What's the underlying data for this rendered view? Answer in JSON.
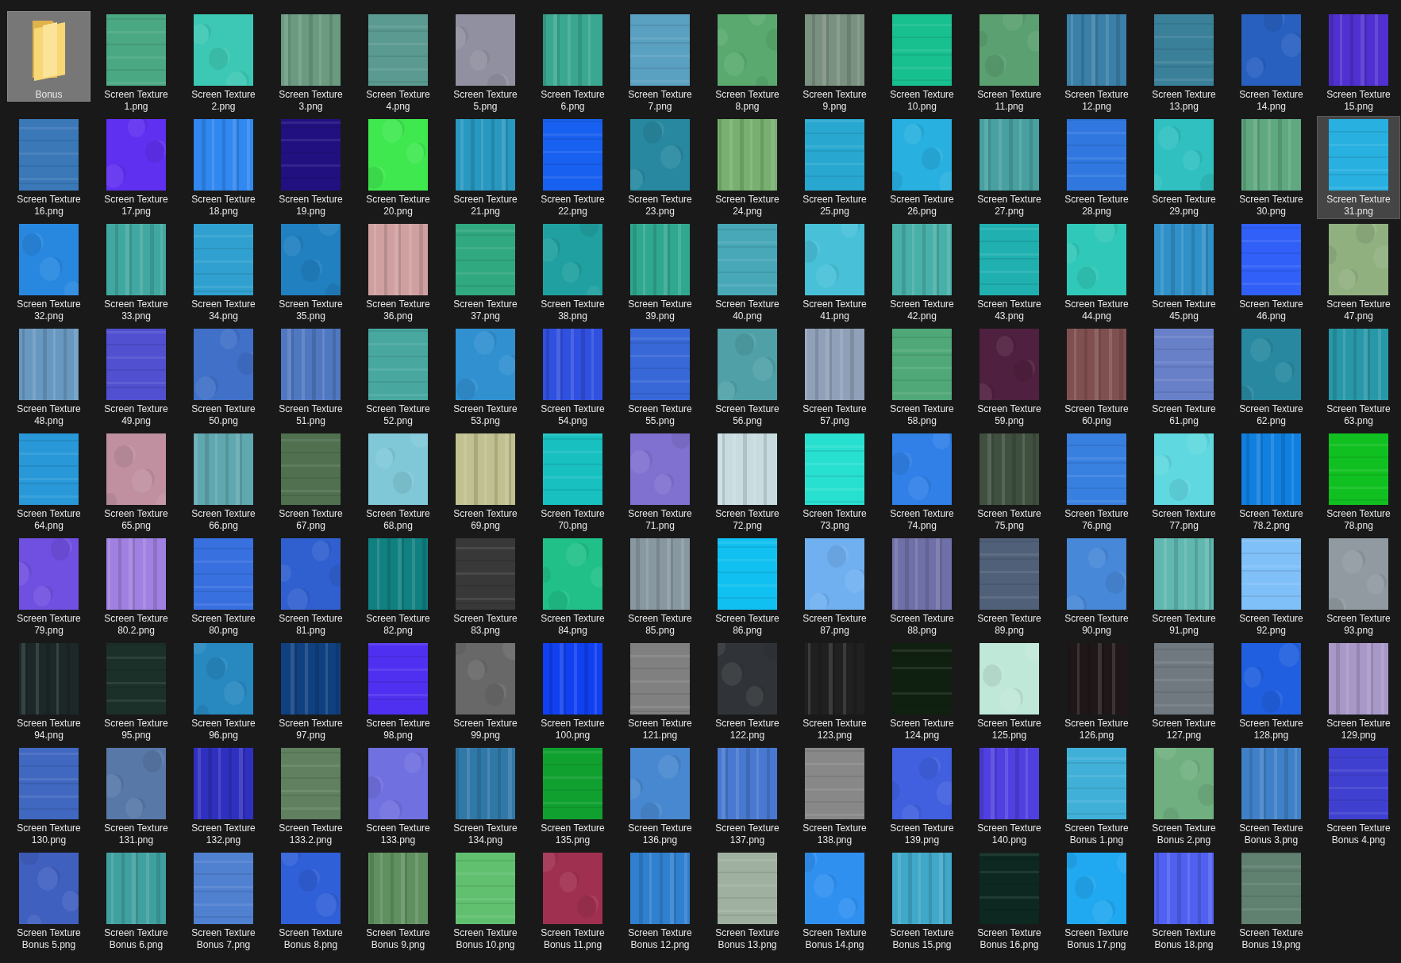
{
  "items": [
    {
      "kind": "folder",
      "label": "Bonus",
      "selected": true,
      "hovered": false
    },
    {
      "kind": "picture",
      "label": "Screen Texture 1.png",
      "selected": false,
      "hovered": false
    },
    {
      "kind": "picture",
      "label": "Screen Texture 2.png",
      "selected": false,
      "hovered": false
    },
    {
      "kind": "picture",
      "label": "Screen Texture 3.png",
      "selected": false,
      "hovered": false
    },
    {
      "kind": "picture",
      "label": "Screen Texture 4.png",
      "selected": false,
      "hovered": false
    },
    {
      "kind": "picture",
      "label": "Screen Texture 5.png",
      "selected": false,
      "hovered": false
    },
    {
      "kind": "picture",
      "label": "Screen Texture 6.png",
      "selected": false,
      "hovered": false
    },
    {
      "kind": "picture",
      "label": "Screen Texture 7.png",
      "selected": false,
      "hovered": false
    },
    {
      "kind": "picture",
      "label": "Screen Texture 8.png",
      "selected": false,
      "hovered": false
    },
    {
      "kind": "picture",
      "label": "Screen Texture 9.png",
      "selected": false,
      "hovered": false
    },
    {
      "kind": "picture",
      "label": "Screen Texture 10.png",
      "selected": false,
      "hovered": false
    },
    {
      "kind": "picture",
      "label": "Screen Texture 11.png",
      "selected": false,
      "hovered": false
    },
    {
      "kind": "picture",
      "label": "Screen Texture 12.png",
      "selected": false,
      "hovered": false
    },
    {
      "kind": "picture",
      "label": "Screen Texture 13.png",
      "selected": false,
      "hovered": false
    },
    {
      "kind": "picture",
      "label": "Screen Texture 14.png",
      "selected": false,
      "hovered": false
    },
    {
      "kind": "picture",
      "label": "Screen Texture 15.png",
      "selected": false,
      "hovered": false
    },
    {
      "kind": "picture",
      "label": "Screen Texture 16.png",
      "selected": false,
      "hovered": false
    },
    {
      "kind": "picture",
      "label": "Screen Texture 17.png",
      "selected": false,
      "hovered": false
    },
    {
      "kind": "picture",
      "label": "Screen Texture 18.png",
      "selected": false,
      "hovered": false
    },
    {
      "kind": "picture",
      "label": "Screen Texture 19.png",
      "selected": false,
      "hovered": false
    },
    {
      "kind": "picture",
      "label": "Screen Texture 20.png",
      "selected": false,
      "hovered": false
    },
    {
      "kind": "picture",
      "label": "Screen Texture 21.png",
      "selected": false,
      "hovered": false
    },
    {
      "kind": "picture",
      "label": "Screen Texture 22.png",
      "selected": false,
      "hovered": false
    },
    {
      "kind": "picture",
      "label": "Screen Texture 23.png",
      "selected": false,
      "hovered": false
    },
    {
      "kind": "picture",
      "label": "Screen Texture 24.png",
      "selected": false,
      "hovered": false
    },
    {
      "kind": "picture",
      "label": "Screen Texture 25.png",
      "selected": false,
      "hovered": false
    },
    {
      "kind": "picture",
      "label": "Screen Texture 26.png",
      "selected": false,
      "hovered": false
    },
    {
      "kind": "picture",
      "label": "Screen Texture 27.png",
      "selected": false,
      "hovered": false
    },
    {
      "kind": "picture",
      "label": "Screen Texture 28.png",
      "selected": false,
      "hovered": false
    },
    {
      "kind": "picture",
      "label": "Screen Texture 29.png",
      "selected": false,
      "hovered": false
    },
    {
      "kind": "picture",
      "label": "Screen Texture 30.png",
      "selected": false,
      "hovered": false
    },
    {
      "kind": "picture",
      "label": "Screen Texture 31.png",
      "selected": false,
      "hovered": true
    },
    {
      "kind": "picture",
      "label": "Screen Texture 32.png",
      "selected": false,
      "hovered": false
    },
    {
      "kind": "picture",
      "label": "Screen Texture 33.png",
      "selected": false,
      "hovered": false
    },
    {
      "kind": "picture",
      "label": "Screen Texture 34.png",
      "selected": false,
      "hovered": false
    },
    {
      "kind": "picture",
      "label": "Screen Texture 35.png",
      "selected": false,
      "hovered": false
    },
    {
      "kind": "picture",
      "label": "Screen Texture 36.png",
      "selected": false,
      "hovered": false
    },
    {
      "kind": "picture",
      "label": "Screen Texture 37.png",
      "selected": false,
      "hovered": false
    },
    {
      "kind": "picture",
      "label": "Screen Texture 38.png",
      "selected": false,
      "hovered": false
    },
    {
      "kind": "picture",
      "label": "Screen Texture 39.png",
      "selected": false,
      "hovered": false
    },
    {
      "kind": "picture",
      "label": "Screen Texture 40.png",
      "selected": false,
      "hovered": false
    },
    {
      "kind": "picture",
      "label": "Screen Texture 41.png",
      "selected": false,
      "hovered": false
    },
    {
      "kind": "picture",
      "label": "Screen Texture 42.png",
      "selected": false,
      "hovered": false
    },
    {
      "kind": "picture",
      "label": "Screen Texture 43.png",
      "selected": false,
      "hovered": false
    },
    {
      "kind": "picture",
      "label": "Screen Texture 44.png",
      "selected": false,
      "hovered": false
    },
    {
      "kind": "picture",
      "label": "Screen Texture 45.png",
      "selected": false,
      "hovered": false
    },
    {
      "kind": "picture",
      "label": "Screen Texture 46.png",
      "selected": false,
      "hovered": false
    },
    {
      "kind": "picture",
      "label": "Screen Texture 47.png",
      "selected": false,
      "hovered": false
    },
    {
      "kind": "picture",
      "label": "Screen Texture 48.png",
      "selected": false,
      "hovered": false
    },
    {
      "kind": "picture",
      "label": "Screen Texture 49.png",
      "selected": false,
      "hovered": false
    },
    {
      "kind": "picture",
      "label": "Screen Texture 50.png",
      "selected": false,
      "hovered": false
    },
    {
      "kind": "picture",
      "label": "Screen Texture 51.png",
      "selected": false,
      "hovered": false
    },
    {
      "kind": "picture",
      "label": "Screen Texture 52.png",
      "selected": false,
      "hovered": false
    },
    {
      "kind": "picture",
      "label": "Screen Texture 53.png",
      "selected": false,
      "hovered": false
    },
    {
      "kind": "picture",
      "label": "Screen Texture 54.png",
      "selected": false,
      "hovered": false
    },
    {
      "kind": "picture",
      "label": "Screen Texture 55.png",
      "selected": false,
      "hovered": false
    },
    {
      "kind": "picture",
      "label": "Screen Texture 56.png",
      "selected": false,
      "hovered": false
    },
    {
      "kind": "picture",
      "label": "Screen Texture 57.png",
      "selected": false,
      "hovered": false
    },
    {
      "kind": "picture",
      "label": "Screen Texture 58.png",
      "selected": false,
      "hovered": false
    },
    {
      "kind": "picture",
      "label": "Screen Texture 59.png",
      "selected": false,
      "hovered": false
    },
    {
      "kind": "picture",
      "label": "Screen Texture 60.png",
      "selected": false,
      "hovered": false
    },
    {
      "kind": "picture",
      "label": "Screen Texture 61.png",
      "selected": false,
      "hovered": false
    },
    {
      "kind": "picture",
      "label": "Screen Texture 62.png",
      "selected": false,
      "hovered": false
    },
    {
      "kind": "picture",
      "label": "Screen Texture 63.png",
      "selected": false,
      "hovered": false
    },
    {
      "kind": "picture",
      "label": "Screen Texture 64.png",
      "selected": false,
      "hovered": false
    },
    {
      "kind": "picture",
      "label": "Screen Texture 65.png",
      "selected": false,
      "hovered": false
    },
    {
      "kind": "picture",
      "label": "Screen Texture 66.png",
      "selected": false,
      "hovered": false
    },
    {
      "kind": "picture",
      "label": "Screen Texture 67.png",
      "selected": false,
      "hovered": false
    },
    {
      "kind": "picture",
      "label": "Screen Texture 68.png",
      "selected": false,
      "hovered": false
    },
    {
      "kind": "picture",
      "label": "Screen Texture 69.png",
      "selected": false,
      "hovered": false
    },
    {
      "kind": "picture",
      "label": "Screen Texture 70.png",
      "selected": false,
      "hovered": false
    },
    {
      "kind": "picture",
      "label": "Screen Texture 71.png",
      "selected": false,
      "hovered": false
    },
    {
      "kind": "picture",
      "label": "Screen Texture 72.png",
      "selected": false,
      "hovered": false
    },
    {
      "kind": "picture",
      "label": "Screen Texture 73.png",
      "selected": false,
      "hovered": false
    },
    {
      "kind": "picture",
      "label": "Screen Texture 74.png",
      "selected": false,
      "hovered": false
    },
    {
      "kind": "picture",
      "label": "Screen Texture 75.png",
      "selected": false,
      "hovered": false
    },
    {
      "kind": "picture",
      "label": "Screen Texture 76.png",
      "selected": false,
      "hovered": false
    },
    {
      "kind": "picture",
      "label": "Screen Texture 77.png",
      "selected": false,
      "hovered": false
    },
    {
      "kind": "picture",
      "label": "Screen Texture 78.2.png",
      "selected": false,
      "hovered": false
    },
    {
      "kind": "picture",
      "label": "Screen Texture 78.png",
      "selected": false,
      "hovered": false
    },
    {
      "kind": "picture",
      "label": "Screen Texture 79.png",
      "selected": false,
      "hovered": false
    },
    {
      "kind": "picture",
      "label": "Screen Texture 80.2.png",
      "selected": false,
      "hovered": false
    },
    {
      "kind": "picture",
      "label": "Screen Texture 80.png",
      "selected": false,
      "hovered": false
    },
    {
      "kind": "picture",
      "label": "Screen Texture 81.png",
      "selected": false,
      "hovered": false
    },
    {
      "kind": "picture",
      "label": "Screen Texture 82.png",
      "selected": false,
      "hovered": false
    },
    {
      "kind": "picture",
      "label": "Screen Texture 83.png",
      "selected": false,
      "hovered": false
    },
    {
      "kind": "picture",
      "label": "Screen Texture 84.png",
      "selected": false,
      "hovered": false
    },
    {
      "kind": "picture",
      "label": "Screen Texture 85.png",
      "selected": false,
      "hovered": false
    },
    {
      "kind": "picture",
      "label": "Screen Texture 86.png",
      "selected": false,
      "hovered": false
    },
    {
      "kind": "picture",
      "label": "Screen Texture 87.png",
      "selected": false,
      "hovered": false
    },
    {
      "kind": "picture",
      "label": "Screen Texture 88.png",
      "selected": false,
      "hovered": false
    },
    {
      "kind": "picture",
      "label": "Screen Texture 89.png",
      "selected": false,
      "hovered": false
    },
    {
      "kind": "picture",
      "label": "Screen Texture 90.png",
      "selected": false,
      "hovered": false
    },
    {
      "kind": "picture",
      "label": "Screen Texture 91.png",
      "selected": false,
      "hovered": false
    },
    {
      "kind": "picture",
      "label": "Screen Texture 92.png",
      "selected": false,
      "hovered": false
    },
    {
      "kind": "picture",
      "label": "Screen Texture 93.png",
      "selected": false,
      "hovered": false
    },
    {
      "kind": "picture",
      "label": "Screen Texture 94.png",
      "selected": false,
      "hovered": false
    },
    {
      "kind": "picture",
      "label": "Screen Texture 95.png",
      "selected": false,
      "hovered": false
    },
    {
      "kind": "picture",
      "label": "Screen Texture 96.png",
      "selected": false,
      "hovered": false
    },
    {
      "kind": "picture",
      "label": "Screen Texture 97.png",
      "selected": false,
      "hovered": false
    },
    {
      "kind": "picture",
      "label": "Screen Texture 98.png",
      "selected": false,
      "hovered": false
    },
    {
      "kind": "picture",
      "label": "Screen Texture 99.png",
      "selected": false,
      "hovered": false
    },
    {
      "kind": "picture",
      "label": "Screen Texture 100.png",
      "selected": false,
      "hovered": false
    },
    {
      "kind": "picture",
      "label": "Screen Texture 121.png",
      "selected": false,
      "hovered": false
    },
    {
      "kind": "picture",
      "label": "Screen Texture 122.png",
      "selected": false,
      "hovered": false
    },
    {
      "kind": "picture",
      "label": "Screen Texture 123.png",
      "selected": false,
      "hovered": false
    },
    {
      "kind": "picture",
      "label": "Screen Texture 124.png",
      "selected": false,
      "hovered": false
    },
    {
      "kind": "picture",
      "label": "Screen Texture 125.png",
      "selected": false,
      "hovered": false
    },
    {
      "kind": "picture",
      "label": "Screen Texture 126.png",
      "selected": false,
      "hovered": false
    },
    {
      "kind": "picture",
      "label": "Screen Texture 127.png",
      "selected": false,
      "hovered": false
    },
    {
      "kind": "picture",
      "label": "Screen Texture 128.png",
      "selected": false,
      "hovered": false
    },
    {
      "kind": "picture",
      "label": "Screen Texture 129.png",
      "selected": false,
      "hovered": false
    },
    {
      "kind": "picture",
      "label": "Screen Texture 130.png",
      "selected": false,
      "hovered": false
    },
    {
      "kind": "picture",
      "label": "Screen Texture 131.png",
      "selected": false,
      "hovered": false
    },
    {
      "kind": "picture",
      "label": "Screen Texture 132.png",
      "selected": false,
      "hovered": false
    },
    {
      "kind": "picture",
      "label": "Screen Texture 133.2.png",
      "selected": false,
      "hovered": false
    },
    {
      "kind": "picture",
      "label": "Screen Texture 133.png",
      "selected": false,
      "hovered": false
    },
    {
      "kind": "picture",
      "label": "Screen Texture 134.png",
      "selected": false,
      "hovered": false
    },
    {
      "kind": "picture",
      "label": "Screen Texture 135.png",
      "selected": false,
      "hovered": false
    },
    {
      "kind": "picture",
      "label": "Screen Texture 136.png",
      "selected": false,
      "hovered": false
    },
    {
      "kind": "picture",
      "label": "Screen Texture 137.png",
      "selected": false,
      "hovered": false
    },
    {
      "kind": "picture",
      "label": "Screen Texture 138.png",
      "selected": false,
      "hovered": false
    },
    {
      "kind": "picture",
      "label": "Screen Texture 139.png",
      "selected": false,
      "hovered": false
    },
    {
      "kind": "picture",
      "label": "Screen Texture 140.png",
      "selected": false,
      "hovered": false
    },
    {
      "kind": "picture",
      "label": "Screen Texture Bonus 1.png",
      "selected": false,
      "hovered": false
    },
    {
      "kind": "picture",
      "label": "Screen Texture Bonus 2.png",
      "selected": false,
      "hovered": false
    },
    {
      "kind": "picture",
      "label": "Screen Texture Bonus 3.png",
      "selected": false,
      "hovered": false
    },
    {
      "kind": "picture",
      "label": "Screen Texture Bonus 4.png",
      "selected": false,
      "hovered": false
    },
    {
      "kind": "picture",
      "label": "Screen Texture Bonus 5.png",
      "selected": false,
      "hovered": false
    },
    {
      "kind": "picture",
      "label": "Screen Texture Bonus 6.png",
      "selected": false,
      "hovered": false
    },
    {
      "kind": "picture",
      "label": "Screen Texture Bonus 7.png",
      "selected": false,
      "hovered": false
    },
    {
      "kind": "picture",
      "label": "Screen Texture Bonus 8.png",
      "selected": false,
      "hovered": false
    },
    {
      "kind": "picture",
      "label": "Screen Texture Bonus 9.png",
      "selected": false,
      "hovered": false
    },
    {
      "kind": "picture",
      "label": "Screen Texture Bonus 10.png",
      "selected": false,
      "hovered": false
    },
    {
      "kind": "picture",
      "label": "Screen Texture Bonus 11.png",
      "selected": false,
      "hovered": false
    },
    {
      "kind": "picture",
      "label": "Screen Texture Bonus 12.png",
      "selected": false,
      "hovered": false
    },
    {
      "kind": "picture",
      "label": "Screen Texture Bonus 13.png",
      "selected": false,
      "hovered": false
    },
    {
      "kind": "picture",
      "label": "Screen Texture Bonus 14.png",
      "selected": false,
      "hovered": false
    },
    {
      "kind": "picture",
      "label": "Screen Texture Bonus 15.png",
      "selected": false,
      "hovered": false
    },
    {
      "kind": "picture",
      "label": "Screen Texture Bonus 16.png",
      "selected": false,
      "hovered": false
    },
    {
      "kind": "picture",
      "label": "Screen Texture Bonus 17.png",
      "selected": false,
      "hovered": false
    },
    {
      "kind": "picture",
      "label": "Screen Texture Bonus 18.png",
      "selected": false,
      "hovered": false
    },
    {
      "kind": "picture",
      "label": "Screen Texture Bonus 19.png",
      "selected": false,
      "hovered": false
    }
  ]
}
